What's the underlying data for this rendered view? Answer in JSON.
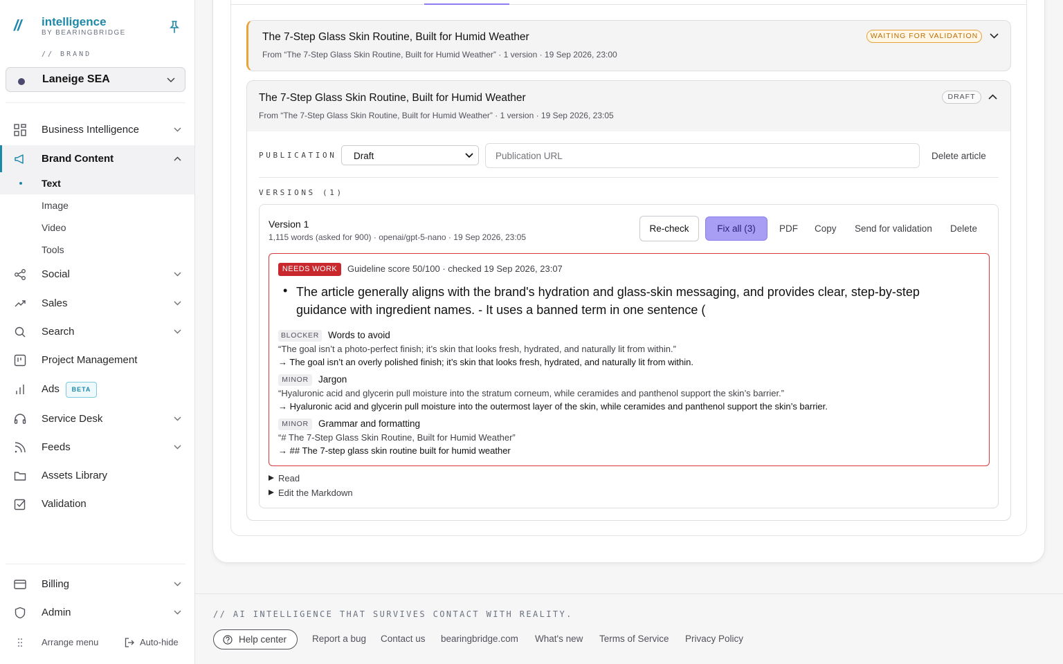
{
  "sidebar": {
    "logo_name": "intelligence",
    "logo_by": "BY BEARINGBRIDGE",
    "brand_label": "// BRAND",
    "brand_selected": "Laneige SEA",
    "nav": [
      {
        "label": "Business Intelligence"
      },
      {
        "label": "Brand Content"
      },
      {
        "label": "Social"
      },
      {
        "label": "Sales"
      },
      {
        "label": "Search"
      },
      {
        "label": "Project Management"
      },
      {
        "label": "Ads"
      },
      {
        "label": "Service Desk"
      },
      {
        "label": "Feeds"
      },
      {
        "label": "Assets Library"
      },
      {
        "label": "Validation"
      },
      {
        "label": "Billing"
      },
      {
        "label": "Admin"
      }
    ],
    "sub_items": [
      "Text",
      "Image",
      "Video",
      "Tools"
    ],
    "beta_badge": "BETA",
    "arrange_menu": "Arrange menu",
    "auto_hide": "Auto-hide"
  },
  "articles": [
    {
      "title": "The 7-Step Glass Skin Routine, Built for Humid Weather",
      "meta": "From “The 7-Step Glass Skin Routine, Built for Humid Weather” · 1 version · 19 Sep 2026, 23:00",
      "status": "WAITING FOR VALIDATION"
    },
    {
      "title": "The 7-Step Glass Skin Routine, Built for Humid Weather",
      "meta": "From “The 7-Step Glass Skin Routine, Built for Humid Weather” · 1 version · 19 Sep 2026, 23:05",
      "status": "DRAFT"
    }
  ],
  "publication": {
    "label": "PUBLICATION",
    "status_value": "Draft",
    "url_placeholder": "Publication URL",
    "delete_article": "Delete article"
  },
  "versions": {
    "label": "VERSIONS (1)",
    "version_title": "Version 1",
    "version_meta": "1,115 words (asked for 900) · openai/gpt-5-nano · 19 Sep 2026, 23:05",
    "actions": {
      "recheck": "Re-check",
      "fix_all": "Fix all (3)",
      "pdf": "PDF",
      "copy": "Copy",
      "send": "Send for validation",
      "delete": "Delete"
    }
  },
  "review": {
    "badge": "NEEDS WORK",
    "score_text": "Guideline score 50/100 · checked 19 Sep 2026, 23:07",
    "summary": "The article generally aligns with the brand's hydration and glass-skin messaging, and provides clear, step-by-step guidance with ingredient names. - It uses a banned term in one sentence (",
    "issues": [
      {
        "severity": "BLOCKER",
        "name": "Words to avoid",
        "quote": "“The goal isn’t a photo-perfect finish; it’s skin that looks fresh, hydrated, and naturally lit from within.”",
        "fix": "→ The goal isn’t an overly polished finish; it’s skin that looks fresh, hydrated, and naturally lit from within."
      },
      {
        "severity": "MINOR",
        "name": "Jargon",
        "quote": "“Hyaluronic acid and glycerin pull moisture into the stratum corneum, while ceramides and panthenol support the skin’s barrier.”",
        "fix": "→ Hyaluronic acid and glycerin pull moisture into the outermost layer of the skin, while ceramides and panthenol support the skin’s barrier."
      },
      {
        "severity": "MINOR",
        "name": "Grammar and formatting",
        "quote": "“# The 7-Step Glass Skin Routine, Built for Humid Weather”",
        "fix": "→ ## The 7-step glass skin routine built for humid weather"
      }
    ],
    "read": "Read",
    "edit_markdown": "Edit the Markdown"
  },
  "footer": {
    "tagline": "// AI INTELLIGENCE THAT SURVIVES CONTACT WITH REALITY.",
    "help_center": "Help center",
    "links": [
      "Report a bug",
      "Contact us",
      "bearingbridge.com",
      "What's new",
      "Terms of Service",
      "Privacy Policy"
    ]
  },
  "colors": {
    "accent": "#1e88a8",
    "purple": "#a89ff5",
    "danger": "#c8272c",
    "warning": "#e8a33a"
  }
}
